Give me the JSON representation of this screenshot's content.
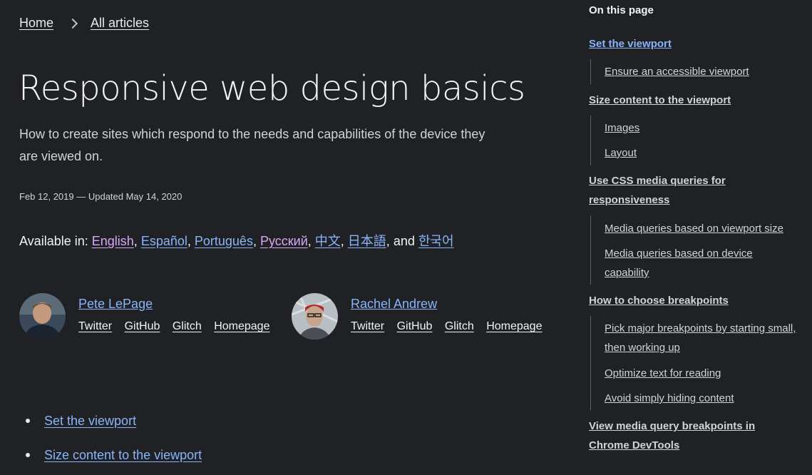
{
  "breadcrumb": {
    "home": "Home",
    "all_articles": "All articles"
  },
  "title": "Responsive web design basics",
  "subtitle": "How to create sites which respond to the needs and capabilities of the device they are viewed on.",
  "dates": "Feb 12, 2019 — Updated May 14, 2020",
  "available": {
    "label": "Available in:",
    "languages": [
      "English",
      "Español",
      "Português",
      "Русский",
      "中文",
      "日本語",
      "한국어"
    ],
    "and": "and"
  },
  "authors": [
    {
      "name": "Pete LePage",
      "links": [
        "Twitter",
        "GitHub",
        "Glitch",
        "Homepage"
      ]
    },
    {
      "name": "Rachel Andrew",
      "links": [
        "Twitter",
        "GitHub",
        "Glitch",
        "Homepage"
      ]
    }
  ],
  "toc": [
    "Set the viewport",
    "Size content to the viewport"
  ],
  "sidebar": {
    "heading": "On this page",
    "sections": [
      {
        "label": "Set the viewport",
        "subs": [
          "Ensure an accessible viewport"
        ]
      },
      {
        "label": "Size content to the viewport",
        "subs": [
          "Images",
          "Layout"
        ]
      },
      {
        "label": "Use CSS media queries for responsiveness",
        "subs": [
          "Media queries based on viewport size",
          "Media queries based on device capability"
        ]
      },
      {
        "label": "How to choose breakpoints",
        "subs": [
          "Pick major breakpoints by starting small, then working up",
          "Optimize text for reading",
          "Avoid simply hiding content"
        ]
      },
      {
        "label": "View media query breakpoints in Chrome DevTools",
        "subs": []
      }
    ]
  },
  "colors": {
    "background": "#202124",
    "link": "#8ab4f8",
    "visited_link": "#d7a8f8",
    "text": "#e8eaed"
  }
}
